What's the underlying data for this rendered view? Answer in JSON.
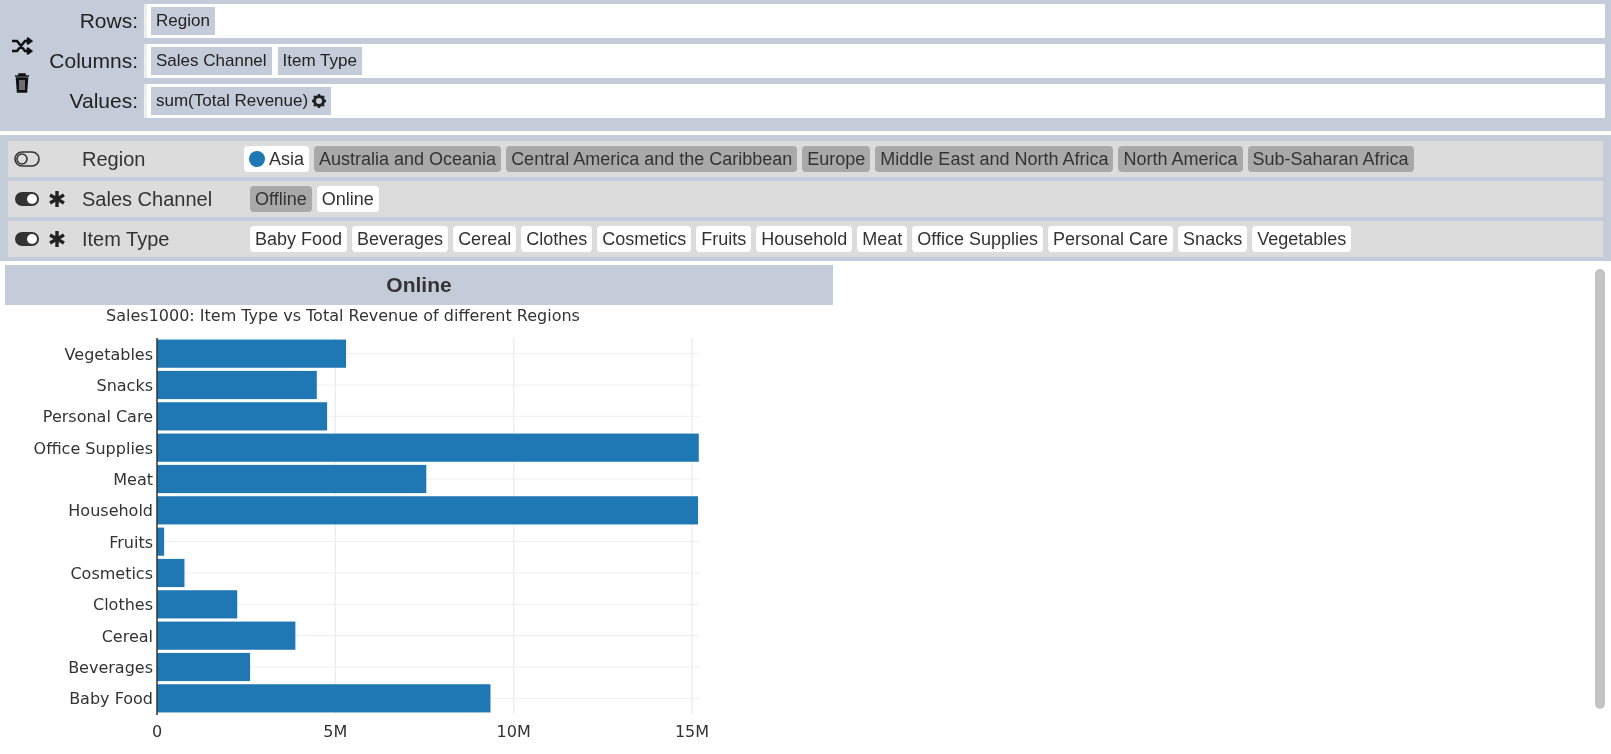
{
  "pivot": {
    "rows": {
      "label": "Rows:",
      "fields": [
        "Region"
      ]
    },
    "columns": {
      "label": "Columns:",
      "fields": [
        "Sales Channel",
        "Item Type"
      ]
    },
    "values": {
      "label": "Values:",
      "fields": [
        "sum(Total Revenue)"
      ]
    }
  },
  "filters": [
    {
      "label": "Region",
      "toggle_on": false,
      "asterisk": false,
      "chips": [
        {
          "label": "Asia",
          "selected": true,
          "dot": true
        },
        {
          "label": "Australia and Oceania",
          "selected": false,
          "dot": false
        },
        {
          "label": "Central America and the Caribbean",
          "selected": false,
          "dot": false
        },
        {
          "label": "Europe",
          "selected": false,
          "dot": false
        },
        {
          "label": "Middle East and North Africa",
          "selected": false,
          "dot": false
        },
        {
          "label": "North America",
          "selected": false,
          "dot": false
        },
        {
          "label": "Sub-Saharan Africa",
          "selected": false,
          "dot": false
        }
      ]
    },
    {
      "label": "Sales Channel",
      "toggle_on": true,
      "asterisk": true,
      "chips": [
        {
          "label": "Offline",
          "selected": false,
          "dot": false
        },
        {
          "label": "Online",
          "selected": true,
          "dot": false
        }
      ]
    },
    {
      "label": "Item Type",
      "toggle_on": true,
      "asterisk": true,
      "chips": [
        {
          "label": "Baby Food",
          "selected": true,
          "dot": false
        },
        {
          "label": "Beverages",
          "selected": true,
          "dot": false
        },
        {
          "label": "Cereal",
          "selected": true,
          "dot": false
        },
        {
          "label": "Clothes",
          "selected": true,
          "dot": false
        },
        {
          "label": "Cosmetics",
          "selected": true,
          "dot": false
        },
        {
          "label": "Fruits",
          "selected": true,
          "dot": false
        },
        {
          "label": "Household",
          "selected": true,
          "dot": false
        },
        {
          "label": "Meat",
          "selected": true,
          "dot": false
        },
        {
          "label": "Office Supplies",
          "selected": true,
          "dot": false
        },
        {
          "label": "Personal Care",
          "selected": true,
          "dot": false
        },
        {
          "label": "Snacks",
          "selected": true,
          "dot": false
        },
        {
          "label": "Vegetables",
          "selected": true,
          "dot": false
        }
      ]
    }
  ],
  "panel": {
    "header": "Online",
    "chart_data": {
      "type": "bar",
      "orientation": "horizontal",
      "title": "Sales1000: Item Type vs Total Revenue of different Regions",
      "categories": [
        "Vegetables",
        "Snacks",
        "Personal Care",
        "Office Supplies",
        "Meat",
        "Household",
        "Fruits",
        "Cosmetics",
        "Clothes",
        "Cereal",
        "Beverages",
        "Baby Food"
      ],
      "series": [
        {
          "color": "#1f77b4",
          "values": [
            5300000,
            4480000,
            4770000,
            15190000,
            7550000,
            15170000,
            200000,
            770000,
            2250000,
            3880000,
            2610000,
            9350000
          ]
        }
      ],
      "xlim": [
        0,
        15200000
      ],
      "grid": true,
      "xticks": [
        {
          "value": 0,
          "label": "0"
        },
        {
          "value": 5000000,
          "label": "5M"
        },
        {
          "value": 10000000,
          "label": "10M"
        },
        {
          "value": 15000000,
          "label": "15M"
        }
      ]
    }
  }
}
